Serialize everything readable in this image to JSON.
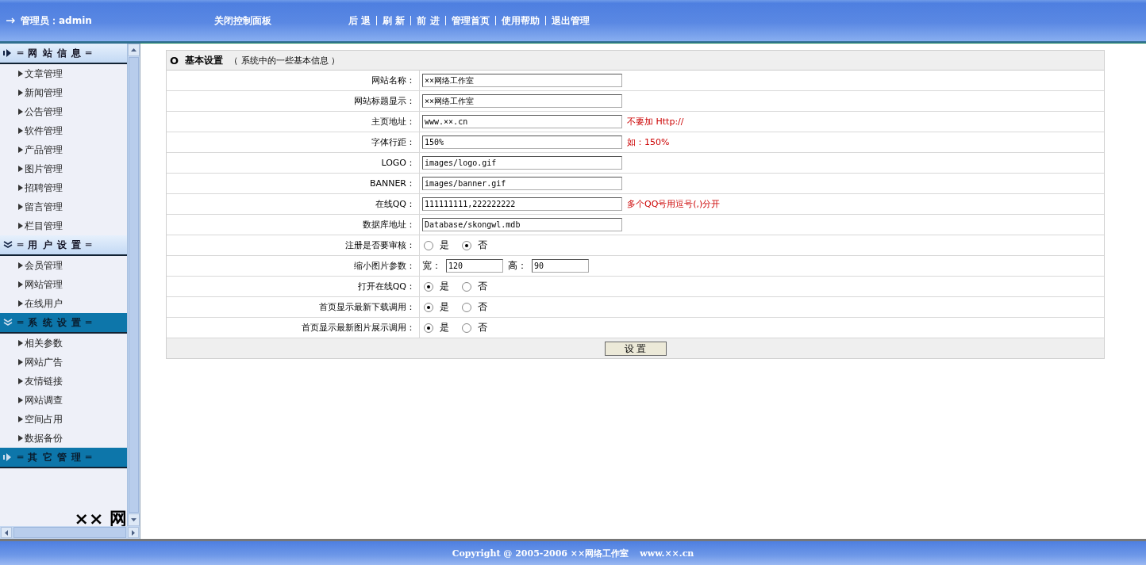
{
  "header": {
    "admin": "管理员：admin",
    "close_panel": "关闭控制面板",
    "nav": [
      "后 退",
      "刷 新",
      "前 进",
      "管理首页",
      "使用帮助",
      "退出管理"
    ]
  },
  "sidebar": {
    "sections": [
      {
        "title": "═ 网 站 信 息 ═",
        "expanded": false,
        "highlighted": false,
        "items": [
          "文章管理",
          "新闻管理",
          "公告管理",
          "软件管理",
          "产品管理",
          "图片管理",
          "招聘管理",
          "留言管理",
          "栏目管理"
        ]
      },
      {
        "title": "═ 用 户 设 置 ═",
        "expanded": true,
        "highlighted": false,
        "items": [
          "会员管理",
          "网站管理",
          "在线用户"
        ]
      },
      {
        "title": "═ 系 统 设 置 ═",
        "expanded": true,
        "highlighted": true,
        "items": [
          "相关参数",
          "网站广告",
          "友情链接",
          "网站调查",
          "空间占用",
          "数据备份"
        ]
      },
      {
        "title": "═ 其 它 管 理 ═",
        "expanded": false,
        "highlighted": true
      }
    ],
    "footer_text": "×× 网"
  },
  "form": {
    "marker": "O",
    "title": "基本设置",
    "subtitle": "（ 系统中的一些基本信息 ）",
    "rows": [
      {
        "kind": "text",
        "label": "网站名称：",
        "value": "××网络工作室"
      },
      {
        "kind": "text",
        "label": "网站标题显示：",
        "value": "××网络工作室"
      },
      {
        "kind": "text",
        "label": "主页地址：",
        "value": "www.××.cn",
        "hint": "不要加 Http://"
      },
      {
        "kind": "text",
        "label": "字体行距：",
        "value": "150%",
        "hint": "如：150%"
      },
      {
        "kind": "text",
        "label": "LOGO：",
        "value": "images/logo.gif"
      },
      {
        "kind": "text",
        "label": "BANNER：",
        "value": "images/banner.gif"
      },
      {
        "kind": "text",
        "label": "在线QQ：",
        "value": "111111111,222222222",
        "hint": "多个QQ号用逗号(,)分开"
      },
      {
        "kind": "text",
        "label": "数据库地址：",
        "value": "Database/skongwl.mdb"
      },
      {
        "kind": "radio",
        "label": "注册是否要审核：",
        "options": [
          {
            "label": "是",
            "selected": false
          },
          {
            "label": "否",
            "selected": true
          }
        ]
      },
      {
        "kind": "size",
        "label": "缩小图片参数：",
        "fields": [
          {
            "label": "宽：",
            "value": "120"
          },
          {
            "label": "高：",
            "value": "90"
          }
        ]
      },
      {
        "kind": "radio",
        "label": "打开在线QQ：",
        "options": [
          {
            "label": "是",
            "selected": true
          },
          {
            "label": "否",
            "selected": false
          }
        ]
      },
      {
        "kind": "radio",
        "label": "首页显示最新下载调用：",
        "options": [
          {
            "label": "是",
            "selected": true
          },
          {
            "label": "否",
            "selected": false
          }
        ]
      },
      {
        "kind": "radio",
        "label": "首页显示最新图片展示调用：",
        "options": [
          {
            "label": "是",
            "selected": true
          },
          {
            "label": "否",
            "selected": false
          }
        ]
      }
    ],
    "submit": "设 置"
  },
  "footer": {
    "copyright": "Copyright @ 2005-2006 ××网络工作室",
    "url": "www.××.cn"
  }
}
